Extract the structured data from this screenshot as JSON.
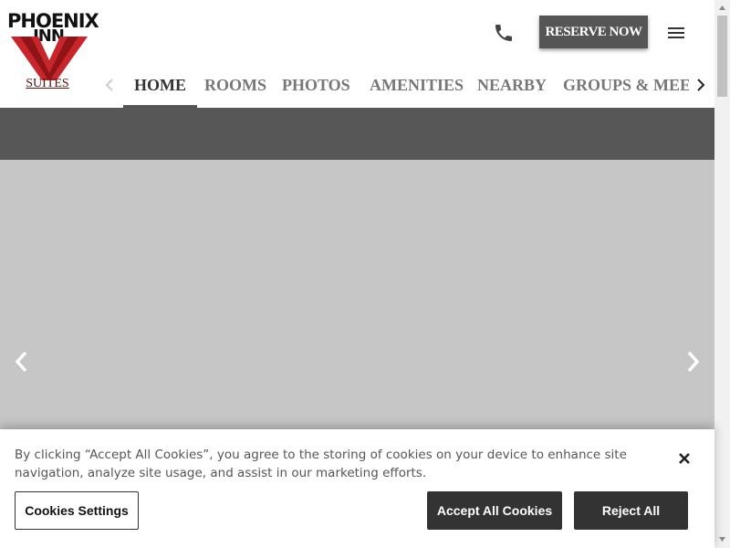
{
  "brand": {
    "logo_line1": "PHOENIX",
    "logo_line2": "INN",
    "logo_line3": "SUITES",
    "logo_accent": "#c8262a"
  },
  "header": {
    "phone_icon": "phone-icon",
    "reserve_label": "RESERVE NOW",
    "menu_icon": "hamburger-menu-icon"
  },
  "nav": {
    "items": [
      {
        "label": "HOME",
        "active": true
      },
      {
        "label": "ROOMS",
        "active": false
      },
      {
        "label": "PHOTOS",
        "active": false
      },
      {
        "label": "AMENITIES",
        "active": false
      },
      {
        "label": "NEARBY",
        "active": false
      },
      {
        "label": "GROUPS & MEETINGS",
        "active": false
      }
    ]
  },
  "cookie": {
    "text": "By clicking “Accept All Cookies”, you agree to the storing of cookies on your device to enhance site navigation, analyze site usage, and assist in our marketing efforts.",
    "settings_label": "Cookies Settings",
    "accept_label": "Accept All Cookies",
    "reject_label": "Reject All"
  },
  "colors": {
    "button_dark": "#333333",
    "reserve_bg": "#555555",
    "band": "#575757",
    "hero_placeholder": "#c6c6c6"
  }
}
